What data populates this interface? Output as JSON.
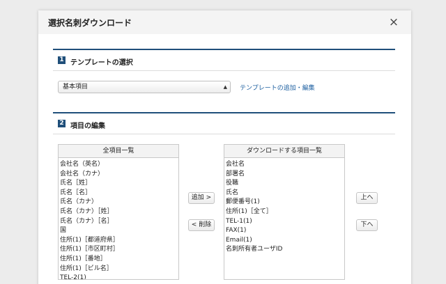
{
  "dialog": {
    "title": "選択名刺ダウンロード",
    "close": "×"
  },
  "section1": {
    "number": "1",
    "title": "テンプレートの選択",
    "select_value": "基本項目",
    "link_text": "テンプレートの追加・編集"
  },
  "section2": {
    "number": "2",
    "title": "項目の編集"
  },
  "all_items": {
    "header": "全項目一覧",
    "items": [
      "会社名（英名）",
      "会社名（カナ）",
      "氏名［姓］",
      "氏名［名］",
      "氏名（カナ）",
      "氏名（カナ）［姓］",
      "氏名（カナ）［名］",
      "国",
      "住所(1)［都道府県］",
      "住所(1)［市区町村］",
      "住所(1)［番地］",
      "住所(1)［ビル名］",
      "TEL-2(1)"
    ]
  },
  "download_items": {
    "header": "ダウンロードする項目一覧",
    "items": [
      "会社名",
      "部署名",
      "役職",
      "氏名",
      "郵便番号(1)",
      "住所(1)［全て］",
      "TEL-1(1)",
      "FAX(1)",
      "Email(1)",
      "名刺所有者ユーザID"
    ]
  },
  "buttons": {
    "add": "追加 >",
    "remove": "< 削除",
    "up": "上へ",
    "down": "下へ"
  }
}
